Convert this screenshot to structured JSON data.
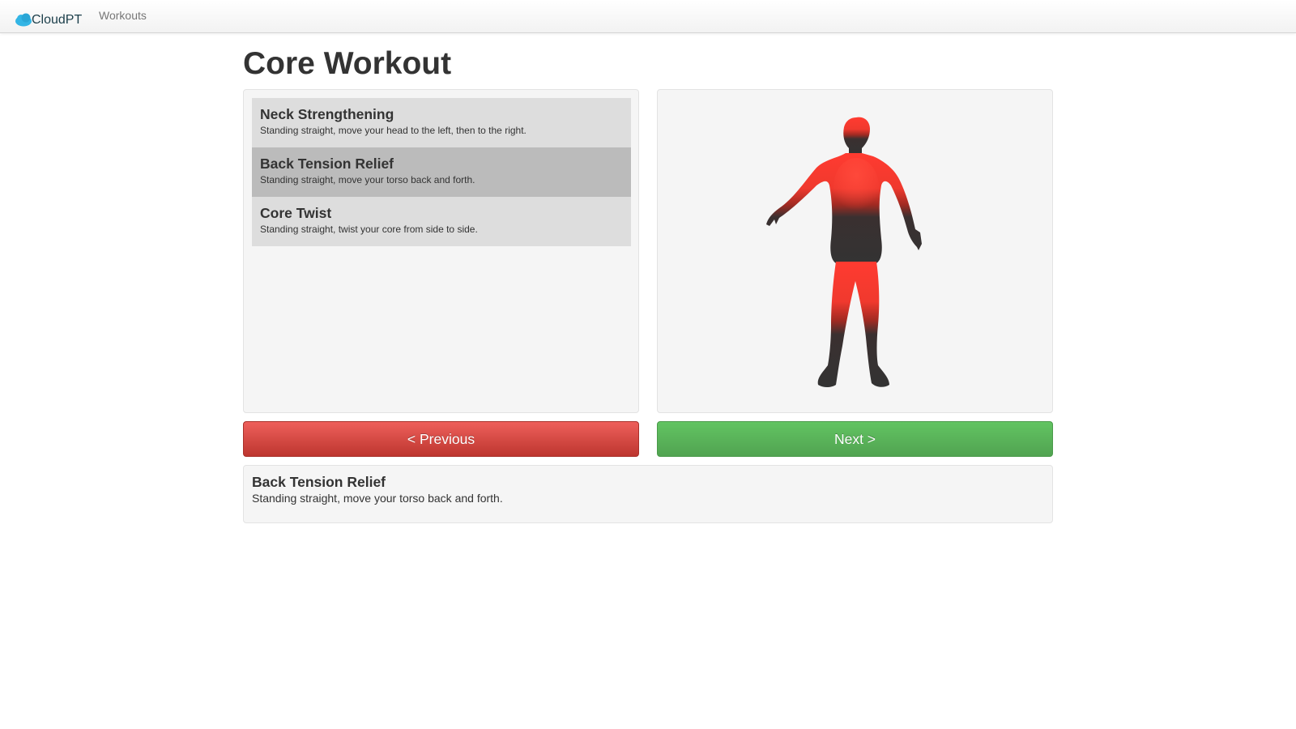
{
  "navbar": {
    "brand": "CloudPT",
    "brand_icon": "cloud-logo-icon",
    "brand_color": "#1b3e4a",
    "links": [
      {
        "label": "Workouts"
      }
    ]
  },
  "page": {
    "title": "Core Workout"
  },
  "exercises": [
    {
      "name": "Neck Strengthening",
      "description": "Standing straight, move your head to the left, then to the right.",
      "active": false
    },
    {
      "name": "Back Tension Relief",
      "description": "Standing straight, move your torso back and forth.",
      "active": true
    },
    {
      "name": "Core Twist",
      "description": "Standing straight, twist your core from side to side.",
      "active": false
    }
  ],
  "model_viewer": {
    "figure": "human-body-model-icon",
    "highlight_color": "#ff3b30",
    "base_color": "#333333"
  },
  "buttons": {
    "previous_label": "< Previous",
    "next_label": "Next >",
    "previous_color": "#da4f49",
    "next_color": "#5bb75b"
  },
  "details": {
    "title": "Back Tension Relief",
    "description": "Standing straight, move your torso back and forth."
  }
}
